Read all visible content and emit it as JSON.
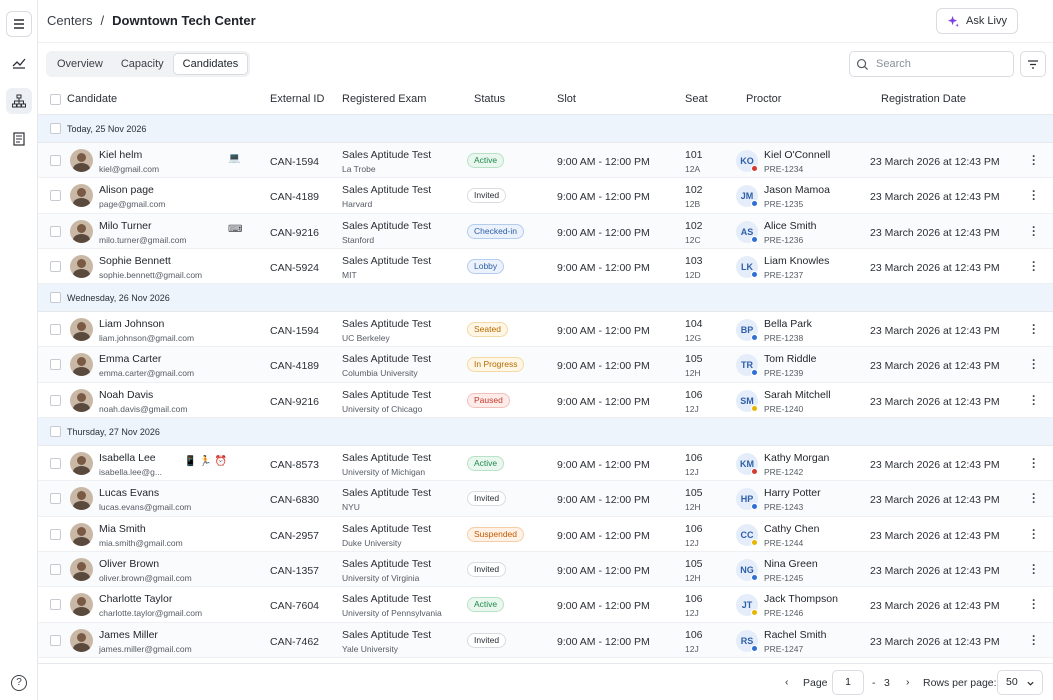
{
  "breadcrumb": {
    "parent": "Centers",
    "separator": "/",
    "current": "Downtown Tech Center"
  },
  "ask_button": {
    "label": "Ask Livy",
    "accent": "#7b3fe4"
  },
  "tabs": [
    {
      "label": "Overview",
      "active": false
    },
    {
      "label": "Capacity",
      "active": false
    },
    {
      "label": "Candidates",
      "active": true
    }
  ],
  "search": {
    "placeholder": "Search",
    "value": ""
  },
  "columns": [
    "Candidate",
    "External ID",
    "Registered Exam",
    "Status",
    "Slot",
    "Seat",
    "Proctor",
    "Registration Date"
  ],
  "status_styles": {
    "Active": {
      "color": "#1e8a4c",
      "bg": "#eaf7ef",
      "border": "#b7e2c6"
    },
    "Invited": {
      "color": "#2b2f36",
      "bg": "#ffffff",
      "border": "#d9dce1"
    },
    "Checked-in": {
      "color": "#2f5fa8",
      "bg": "#ebf2fc",
      "border": "#b4cdef"
    },
    "Lobby": {
      "color": "#2f5fa8",
      "bg": "#ebf2fc",
      "border": "#b4cdef"
    },
    "Seated": {
      "color": "#b36b00",
      "bg": "#fff6e5",
      "border": "#f3d9a4"
    },
    "In Progress": {
      "color": "#b36b00",
      "bg": "#fff6e5",
      "border": "#f3d9a4"
    },
    "Paused": {
      "color": "#c0392b",
      "bg": "#fdecea",
      "border": "#f3c1bb"
    },
    "Suspended": {
      "color": "#c25a00",
      "bg": "#fff1e6",
      "border": "#f5cda8"
    }
  },
  "groups": [
    {
      "label": "Today, 25 Nov 2026",
      "rows": [
        {
          "name": "Kiel helm",
          "email": "kiel@gmail.com",
          "icons": "💻",
          "external_id": "CAN-1594",
          "exam": "Sales Aptitude Test",
          "org": "La Trobe",
          "status": "Active",
          "slot": "9:00 AM - 12:00 PM",
          "seat": "101",
          "seat_sub": "12A",
          "proctor_initials": "KO",
          "proctor_dot": "#d63a2f",
          "proctor": "Kiel O'Connell",
          "proctor_id": "PRE-1234",
          "reg_date": "23 March 2026 at 12:43 PM"
        },
        {
          "name": "Alison page",
          "email": "page@gmail.com",
          "icons": "",
          "external_id": "CAN-4189",
          "exam": "Sales Aptitude Test",
          "org": "Harvard",
          "status": "Invited",
          "slot": "9:00 AM - 12:00 PM",
          "seat": "102",
          "seat_sub": "12B",
          "proctor_initials": "JM",
          "proctor_dot": "#2f6fd6",
          "proctor": "Jason Mamoa",
          "proctor_id": "PRE-1235",
          "reg_date": "23 March 2026 at 12:43 PM"
        },
        {
          "name": "Milo Turner",
          "email": "milo.turner@gmail.com",
          "icons": "⌨",
          "external_id": "CAN-9216",
          "exam": "Sales Aptitude Test",
          "org": "Stanford",
          "status": "Checked-in",
          "slot": "9:00 AM - 12:00 PM",
          "seat": "102",
          "seat_sub": "12C",
          "proctor_initials": "AS",
          "proctor_dot": "#2f6fd6",
          "proctor": "Alice Smith",
          "proctor_id": "PRE-1236",
          "reg_date": "23 March 2026 at 12:43 PM"
        },
        {
          "name": "Sophie Bennett",
          "email": "sophie.bennett@gmail.com",
          "icons": "",
          "external_id": "CAN-5924",
          "exam": "Sales Aptitude Test",
          "org": "MIT",
          "status": "Lobby",
          "slot": "9:00 AM - 12:00 PM",
          "seat": "103",
          "seat_sub": "12D",
          "proctor_initials": "LK",
          "proctor_dot": "#2f6fd6",
          "proctor": "Liam Knowles",
          "proctor_id": "PRE-1237",
          "reg_date": "23 March 2026 at 12:43 PM"
        }
      ]
    },
    {
      "label": "Wednesday, 26 Nov 2026",
      "rows": [
        {
          "name": "Liam Johnson",
          "email": "liam.johnson@gmail.com",
          "icons": "",
          "external_id": "CAN-1594",
          "exam": "Sales Aptitude Test",
          "org": "UC Berkeley",
          "status": "Seated",
          "slot": "9:00 AM - 12:00 PM",
          "seat": "104",
          "seat_sub": "12G",
          "proctor_initials": "BP",
          "proctor_dot": "#2f6fd6",
          "proctor": "Bella Park",
          "proctor_id": "PRE-1238",
          "reg_date": "23 March 2026 at 12:43 PM"
        },
        {
          "name": "Emma Carter",
          "email": "emma.carter@gmail.com",
          "icons": "",
          "external_id": "CAN-4189",
          "exam": "Sales Aptitude Test",
          "org": "Columbia University",
          "status": "In Progress",
          "slot": "9:00 AM - 12:00 PM",
          "seat": "105",
          "seat_sub": "12H",
          "proctor_initials": "TR",
          "proctor_dot": "#2f6fd6",
          "proctor": "Tom Riddle",
          "proctor_id": "PRE-1239",
          "reg_date": "23 March 2026 at 12:43 PM"
        },
        {
          "name": "Noah Davis",
          "email": "noah.davis@gmail.com",
          "icons": "",
          "external_id": "CAN-9216",
          "exam": "Sales Aptitude Test",
          "org": "University of Chicago",
          "status": "Paused",
          "slot": "9:00 AM - 12:00 PM",
          "seat": "106",
          "seat_sub": "12J",
          "proctor_initials": "SM",
          "proctor_dot": "#e8b500",
          "proctor": "Sarah Mitchell",
          "proctor_id": "PRE-1240",
          "reg_date": "23 March 2026 at 12:43 PM"
        }
      ]
    },
    {
      "label": "Thursday, 27 Nov 2026",
      "rows": [
        {
          "name": "Isabella Lee",
          "email": "isabella.lee@g...",
          "icons": "📱  🏃  ⏰",
          "external_id": "CAN-8573",
          "exam": "Sales Aptitude Test",
          "org": "University of Michigan",
          "status": "Active",
          "slot": "9:00 AM - 12:00 PM",
          "seat": "106",
          "seat_sub": "12J",
          "proctor_initials": "KM",
          "proctor_dot": "#d63a2f",
          "proctor": "Kathy Morgan",
          "proctor_id": "PRE-1242",
          "reg_date": "23 March 2026 at 12:43 PM"
        },
        {
          "name": "Lucas Evans",
          "email": "lucas.evans@gmail.com",
          "icons": "",
          "external_id": "CAN-6830",
          "exam": "Sales Aptitude Test",
          "org": "NYU",
          "status": "Invited",
          "slot": "9:00 AM - 12:00 PM",
          "seat": "105",
          "seat_sub": "12H",
          "proctor_initials": "HP",
          "proctor_dot": "#2f6fd6",
          "proctor": "Harry Potter",
          "proctor_id": "PRE-1243",
          "reg_date": "23 March 2026 at 12:43 PM"
        },
        {
          "name": "Mia Smith",
          "email": "mia.smith@gmail.com",
          "icons": "",
          "external_id": "CAN-2957",
          "exam": "Sales Aptitude Test",
          "org": "Duke University",
          "status": "Suspended",
          "slot": "9:00 AM - 12:00 PM",
          "seat": "106",
          "seat_sub": "12J",
          "proctor_initials": "CC",
          "proctor_dot": "#e8b500",
          "proctor": "Cathy Chen",
          "proctor_id": "PRE-1244",
          "reg_date": "23 March 2026 at 12:43 PM"
        },
        {
          "name": "Oliver Brown",
          "email": "oliver.brown@gmail.com",
          "icons": "",
          "external_id": "CAN-1357",
          "exam": "Sales Aptitude Test",
          "org": "University of Virginia",
          "status": "Invited",
          "slot": "9:00 AM - 12:00 PM",
          "seat": "105",
          "seat_sub": "12H",
          "proctor_initials": "NG",
          "proctor_dot": "#2f6fd6",
          "proctor": "Nina Green",
          "proctor_id": "PRE-1245",
          "reg_date": "23 March 2026 at 12:43 PM"
        },
        {
          "name": "Charlotte Taylor",
          "email": "charlotte.taylor@gmail.com",
          "icons": "",
          "external_id": "CAN-7604",
          "exam": "Sales Aptitude Test",
          "org": "University of Pennsylvania",
          "status": "Active",
          "slot": "9:00 AM - 12:00 PM",
          "seat": "106",
          "seat_sub": "12J",
          "proctor_initials": "JT",
          "proctor_dot": "#e8b500",
          "proctor": "Jack Thompson",
          "proctor_id": "PRE-1246",
          "reg_date": "23 March 2026 at 12:43 PM"
        },
        {
          "name": "James Miller",
          "email": "james.miller@gmail.com",
          "icons": "",
          "external_id": "CAN-7462",
          "exam": "Sales Aptitude Test",
          "org": "Yale University",
          "status": "Invited",
          "slot": "9:00 AM - 12:00 PM",
          "seat": "106",
          "seat_sub": "12J",
          "proctor_initials": "RS",
          "proctor_dot": "#2f6fd6",
          "proctor": "Rachel Smith",
          "proctor_id": "PRE-1247",
          "reg_date": "23 March 2026 at 12:43 PM"
        }
      ]
    }
  ],
  "pagination": {
    "page_label": "Page",
    "current_page": "1",
    "separator": "-",
    "total_pages": "3",
    "rows_label": "Rows per page:",
    "rows_value": "50"
  }
}
